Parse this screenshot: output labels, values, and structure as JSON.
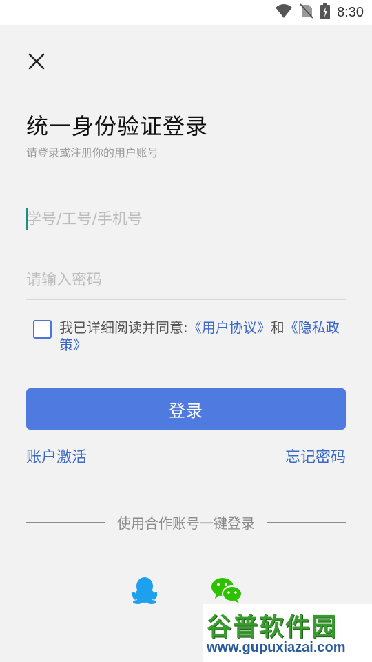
{
  "status_bar": {
    "time": "8:30"
  },
  "header": {
    "title": "统一身份验证登录",
    "subtitle": "请登录或注册你的用户账号"
  },
  "form": {
    "account_placeholder": "学号/工号/手机号",
    "password_placeholder": "请输入密码"
  },
  "agreement": {
    "prefix": "我已详细阅读并同意:",
    "user_agreement": "《用户协议》",
    "and": "和",
    "privacy_policy": "《隐私政策》",
    "checked": false
  },
  "login_button": "登录",
  "links": {
    "activate": "账户激活",
    "forgot": "忘记密码"
  },
  "partner": {
    "label": "使用合作账号一键登录",
    "providers": [
      "qq-icon",
      "wechat-icon"
    ]
  },
  "watermark": {
    "chinese": "谷普软件园",
    "url": "www.gupuxiazai.com"
  },
  "colors": {
    "primary": "#4f7adf",
    "link": "#3a68c9",
    "qq": "#1ea0ef",
    "wechat": "#2dc100"
  }
}
